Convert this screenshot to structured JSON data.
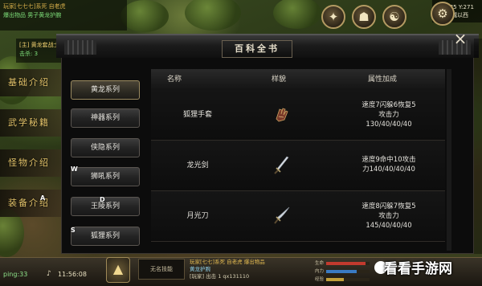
{
  "chat_top": {
    "line1": "玩家[七七七]系死 自老虎",
    "line2": "爆出物品 男子黄龙护腕"
  },
  "hud": {
    "coords": "X:335 Y:271",
    "location": "长城以西"
  },
  "char_info": {
    "name": "[主] 黄龙套战士",
    "detail": "击杀: 3"
  },
  "side_tabs": [
    {
      "label": "基础介绍"
    },
    {
      "label": "武学秘籍"
    },
    {
      "label": "怪物介绍"
    },
    {
      "label": "装备介绍"
    }
  ],
  "panel": {
    "title": "百科全书",
    "close": "×"
  },
  "categories": [
    {
      "label": "黄龙系列"
    },
    {
      "label": "神器系列"
    },
    {
      "label": "侠隐系列"
    },
    {
      "label": "狮吼系列"
    },
    {
      "label": "王陵系列"
    },
    {
      "label": "狐狸系列"
    }
  ],
  "table": {
    "headers": {
      "name": "名称",
      "icon": "样貌",
      "attr": "属性加成"
    },
    "rows": [
      {
        "name": "狐狸手套",
        "attr_line1": "速度7闪躲6恢复5",
        "attr_line2": "攻击力",
        "attr_line3": "130/40/40/40",
        "icon": "glove-icon"
      },
      {
        "name": "龙光剑",
        "attr_line1": "速度9命中10攻击",
        "attr_line2": "力140/40/40/40",
        "attr_line3": "",
        "icon": "sword-icon"
      },
      {
        "name": "月光刀",
        "attr_line1": "速度8闪躲7恢复5",
        "attr_line2": "攻击力",
        "attr_line3": "145/40/40/40",
        "icon": "blade-icon"
      }
    ]
  },
  "floating_letters": {
    "w": "W",
    "a": "A",
    "d": "D",
    "s": "S"
  },
  "bottom": {
    "ping": "ping:33",
    "clock": "11:56:08",
    "skill_box": "无名技能",
    "chat_line1": "玩家[七七]系死 自老虎 爆出物品",
    "chat_line2": "黄龙护腕",
    "chat_line3": "[玩家] 出击 1 qx131110",
    "bar_labels": [
      "生命",
      "内力",
      "经验"
    ],
    "watermark": "看看手游网"
  },
  "colors": {
    "hp": "#c23a2e",
    "mp": "#3a7ac2",
    "exp": "#c2a03a"
  }
}
